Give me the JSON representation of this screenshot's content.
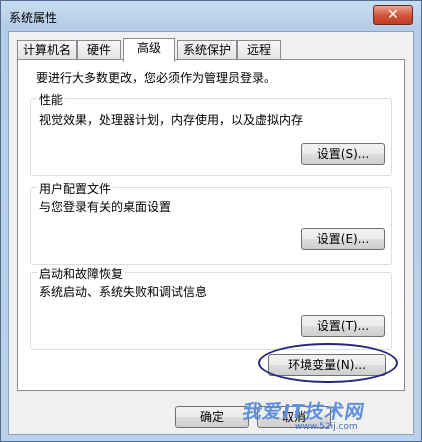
{
  "window": {
    "title": "系统属性",
    "close_glyph": "✕"
  },
  "tabs": [
    {
      "label": "计算机名",
      "active": false
    },
    {
      "label": "硬件",
      "active": false
    },
    {
      "label": "高级",
      "active": true
    },
    {
      "label": "系统保护",
      "active": false
    },
    {
      "label": "远程",
      "active": false
    }
  ],
  "admin_note": "要进行大多数更改，您必须作为管理员登录。",
  "performance": {
    "title": "性能",
    "description": "视觉效果，处理器计划，内存使用，以及虚拟内存",
    "button": "设置(S)..."
  },
  "user_profiles": {
    "title": "用户配置文件",
    "description": "与您登录有关的桌面设置",
    "button": "设置(E)..."
  },
  "startup_recovery": {
    "title": "启动和故障恢复",
    "description": "系统启动、系统失败和调试信息",
    "button": "设置(T)..."
  },
  "env_button": "环境变量(N)...",
  "dialog_buttons": {
    "ok": "确定",
    "cancel": "取消"
  },
  "watermark": {
    "text": "我爱IT技术网",
    "url": "www.52ij.com"
  },
  "colors": {
    "annotation_circle": "#27267a",
    "close_button": "#c13a1f"
  }
}
